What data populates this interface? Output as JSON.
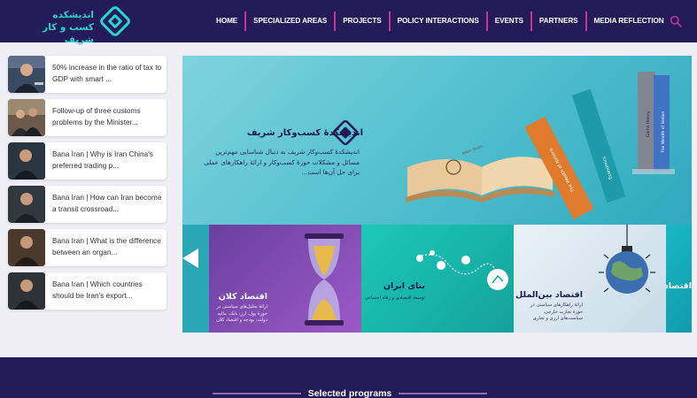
{
  "header": {
    "logo_text_line1": "اندیشکده",
    "logo_text_line2": "کسب و کار شریف",
    "nav": [
      "HOME",
      "SPECIALIZED AREAS",
      "PROJECTS",
      "POLICY INTERACTIONS",
      "EVENTS",
      "PARTNERS",
      "MEDIA REFLECTION"
    ],
    "search_icon": "search-icon"
  },
  "news": [
    {
      "title": "50% increase in the ratio of tax to GDP with smart ..."
    },
    {
      "title": "Follow-up of three customs problems by the Minister..."
    },
    {
      "title": "Bana Iran | Why is Iran China's preferred trading p..."
    },
    {
      "title": "Bana Iran | How can Iran become a transit crossroad..."
    },
    {
      "title": "Bana Iran | What is the difference between an organ..."
    },
    {
      "title": "Bana Iran | Which countries should be Iran's export..."
    }
  ],
  "banner": {
    "title": "اندیشکدهٔ کسب‌وکار شریف",
    "body": "اندیشکدهٔ کسب‌وکار شریف به دنبال شناسایی مهم‌ترین مسائل و مشکلات حوزهٔ کسب‌وکار و ارائهٔ راهکارهای عملی برای حل آن‌ها است...",
    "book_spine_1": "The Wealth of Nations",
    "book_spine_2": "Economics",
    "book_spine_3": "Game theory",
    "book_spine_4": "The Wealth of Nation"
  },
  "carousel": {
    "slides": [
      {
        "title": "اقتصاد کلان",
        "subtitle": "ارائهٔ تحلیل‌های سیاستی در حوزهٔ پول، ارز، بانک، مالیه دولت، بودجه و اقتصاد کلان"
      },
      {
        "title": "بنای ایران",
        "subtitle": "توسعهٔ اقتصادی و رفاه اجتماعی"
      },
      {
        "title": "اقتصاد بین‌الملل",
        "subtitle": "ارائهٔ راهکارهای سیاستی در حوزهٔ تجارت خارجی، سیاست‌های ارزی و تجاری"
      },
      {
        "title": "اقتصاد ...",
        "subtitle": ""
      }
    ]
  },
  "band": {
    "title": "Selected programs"
  },
  "colors": {
    "header_bg": "#241b5a",
    "nav_separator": "#c0398f",
    "accent_teal": "#2dd4c8",
    "page_bg": "#f0eff6"
  }
}
